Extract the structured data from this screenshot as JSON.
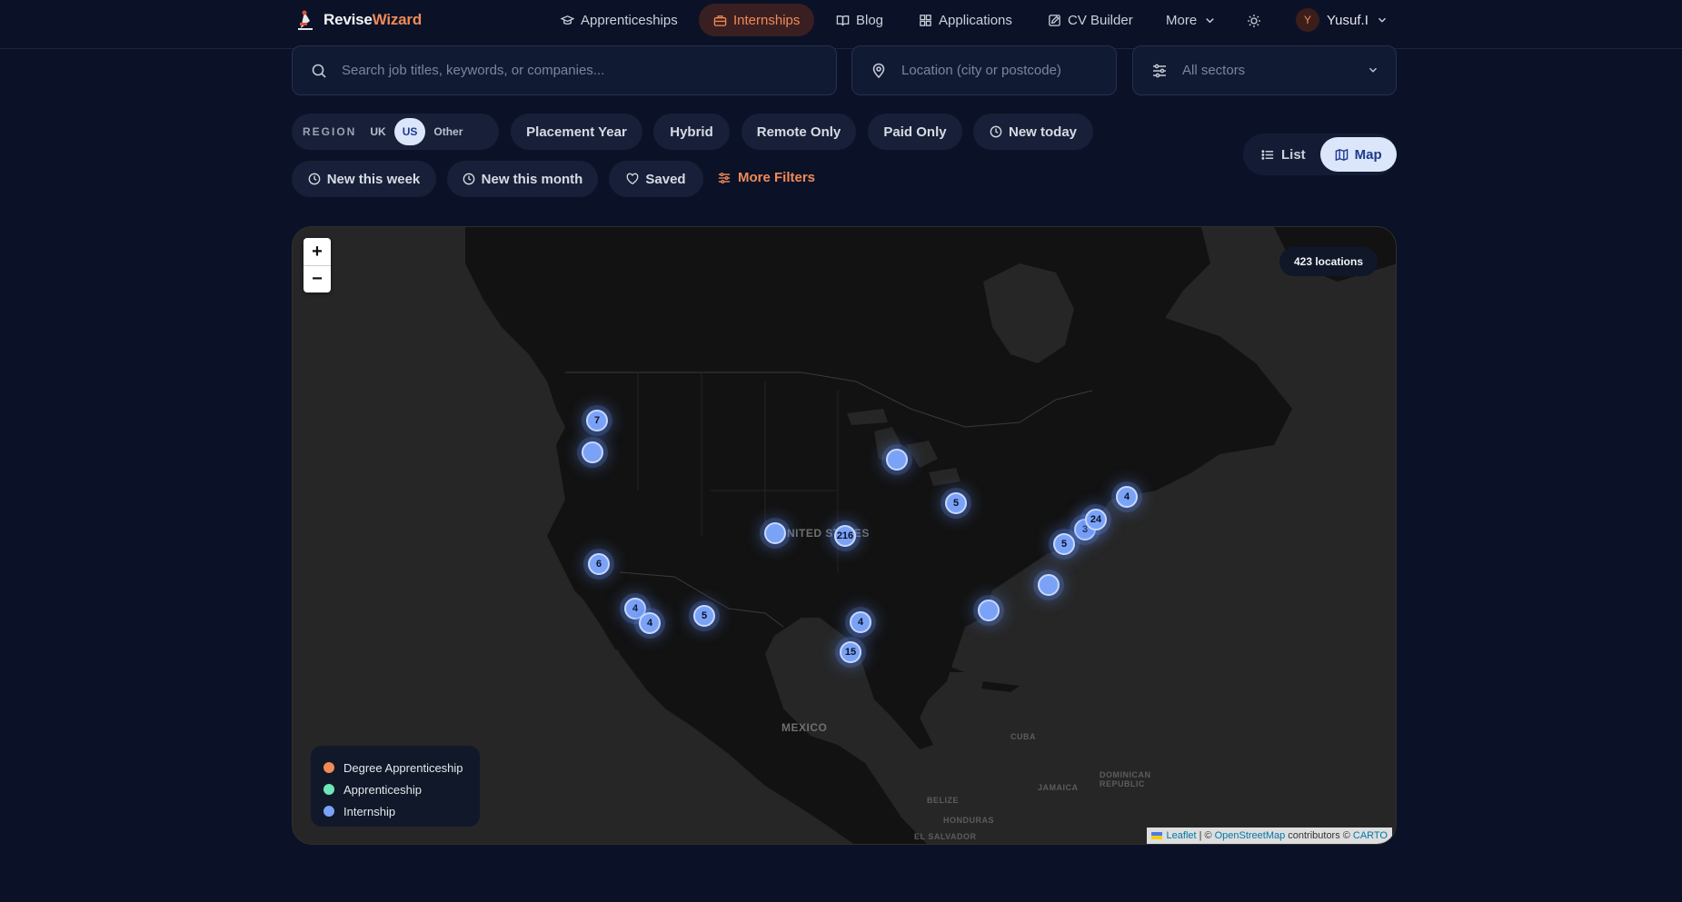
{
  "brand": {
    "name_a": "Revise",
    "name_b": "Wizard"
  },
  "nav": {
    "items": [
      {
        "label": "Apprenticeships",
        "icon": "graduation-cap-icon"
      },
      {
        "label": "Internships",
        "icon": "briefcase-icon",
        "active": true
      },
      {
        "label": "Blog",
        "icon": "book-icon"
      },
      {
        "label": "Applications",
        "icon": "grid-icon"
      },
      {
        "label": "CV Builder",
        "icon": "edit-icon"
      },
      {
        "label": "More",
        "icon": "chevron-down-icon"
      }
    ],
    "user": {
      "initial": "Y",
      "name": "Yusuf.I"
    }
  },
  "search": {
    "placeholder": "Search job titles, keywords, or companies...",
    "location_placeholder": "Location (city or postcode)",
    "sector_value": "All sectors"
  },
  "filters": {
    "region_label": "REGION",
    "region_options": [
      "UK",
      "US",
      "Other"
    ],
    "region_selected": "US",
    "chips": [
      "Placement Year",
      "Hybrid",
      "Remote Only",
      "Paid Only",
      "New today",
      "New this week",
      "New this month",
      "Saved"
    ],
    "more_filters": "More Filters"
  },
  "view": {
    "list": "List",
    "map": "Map",
    "selected": "Map"
  },
  "map": {
    "locations_badge": "423 locations",
    "zoom_in": "+",
    "zoom_out": "−",
    "clusters": [
      "7",
      "",
      "6",
      "4",
      "4",
      "5",
      "",
      "216",
      "4",
      "15",
      "",
      "5",
      "3",
      "24",
      "5",
      "4",
      "",
      ""
    ],
    "labels": [
      "NITED STATES",
      "MEXICO",
      "CUBA",
      "BELIZE",
      "HONDURAS",
      "EL SALVADOR",
      "JAMAICA",
      "DOMINICAN REPUBLIC"
    ],
    "legend": [
      {
        "label": "Degree Apprenticeship",
        "color": "#f08a56"
      },
      {
        "label": "Apprenticeship",
        "color": "#6ee7b7"
      },
      {
        "label": "Internship",
        "color": "#7aa2f7"
      }
    ],
    "attribution": {
      "leaflet": "Leaflet",
      "sep1": "| ©",
      "osm": "OpenStreetMap",
      "contrib": "contributors ©",
      "carto": "CARTO"
    }
  }
}
